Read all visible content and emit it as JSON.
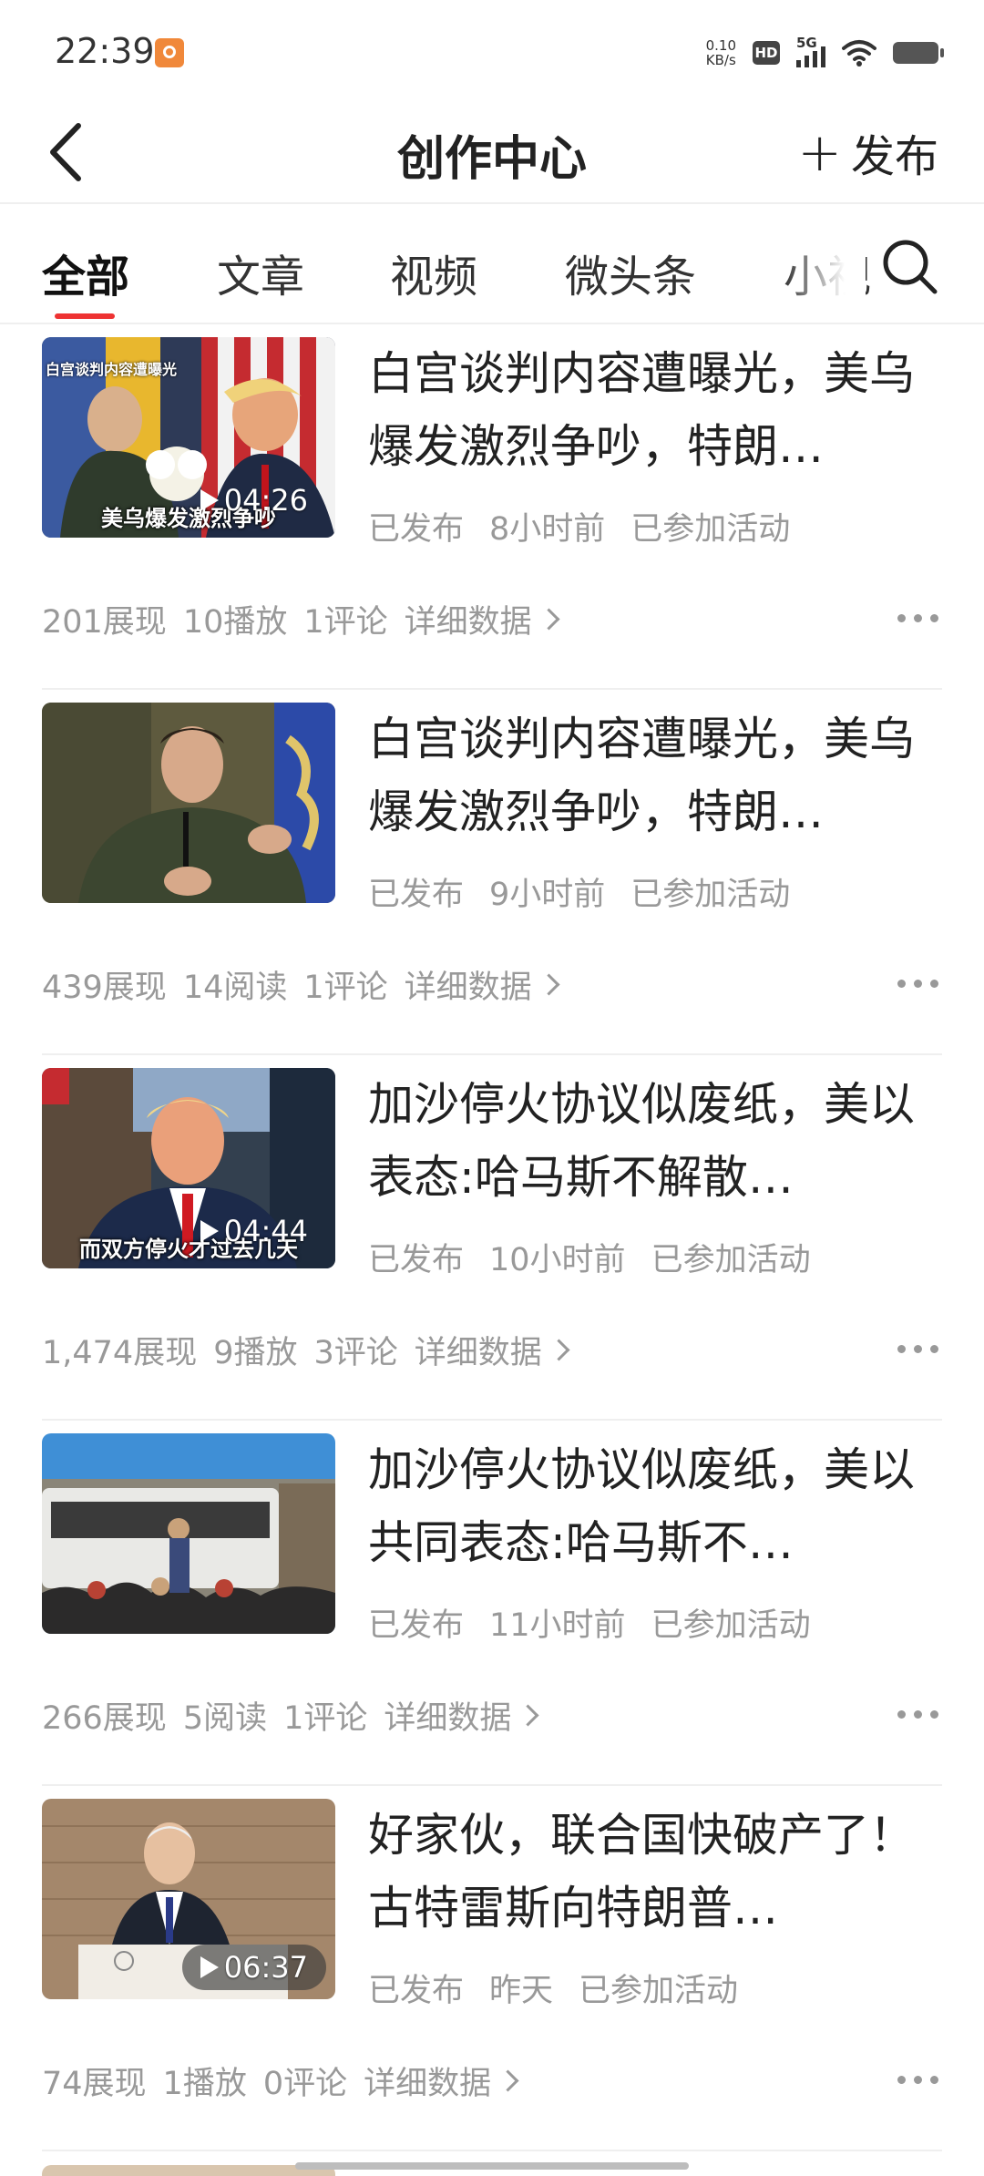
{
  "status_bar": {
    "time": "22:39",
    "net_speed": "0.10",
    "net_unit": "KB/s",
    "hd": "HD",
    "network": "5G"
  },
  "header": {
    "title": "创作中心",
    "publish_label": "发布"
  },
  "tabs": [
    "全部",
    "文章",
    "视频",
    "微头条",
    "小视"
  ],
  "items": [
    {
      "headline": "白宫谈判内容遭曝光，美乌爆发激烈争吵，特朗…",
      "status": "已发布",
      "time": "8小时前",
      "activity": "已参加活动",
      "views": "201展现",
      "plays": "10播放",
      "comments": "1评论",
      "detail": "详细数据",
      "duration": "04:26",
      "thumb_caption": "美乌爆发激烈争吵",
      "thumb_top_caption": "白宫谈判内容遭曝光"
    },
    {
      "headline": "白宫谈判内容遭曝光，美乌爆发激烈争吵，特朗…",
      "status": "已发布",
      "time": "9小时前",
      "activity": "已参加活动",
      "views": "439展现",
      "plays": "14阅读",
      "comments": "1评论",
      "detail": "详细数据"
    },
    {
      "headline": "加沙停火协议似废纸，美以表态:哈马斯不解散…",
      "status": "已发布",
      "time": "10小时前",
      "activity": "已参加活动",
      "views": "1,474展现",
      "plays": "9播放",
      "comments": "3评论",
      "detail": "详细数据",
      "duration": "04:44",
      "thumb_caption": "而双方停火才过去几天"
    },
    {
      "headline": "加沙停火协议似废纸，美以共同表态:哈马斯不…",
      "status": "已发布",
      "time": "11小时前",
      "activity": "已参加活动",
      "views": "266展现",
      "plays": "5阅读",
      "comments": "1评论",
      "detail": "详细数据"
    },
    {
      "headline": "好家伙，联合国快破产了！古特雷斯向特朗普…",
      "status": "已发布",
      "time": "昨天",
      "activity": "已参加活动",
      "views": "74展现",
      "plays": "1播放",
      "comments": "0评论",
      "detail": "详细数据",
      "duration": "06:37"
    }
  ],
  "colors": {
    "accent": "#e33333",
    "meta_text": "#999999"
  }
}
